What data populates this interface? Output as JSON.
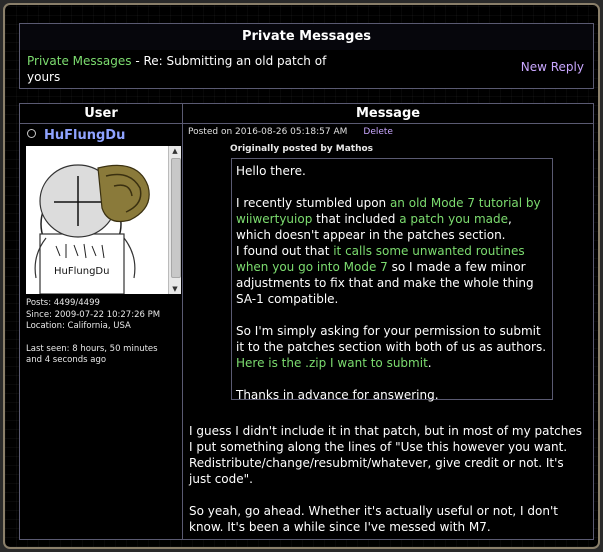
{
  "header": {
    "title": "Private Messages"
  },
  "subheader": {
    "breadcrumb_link": "Private Messages",
    "breadcrumb_sep": " - ",
    "breadcrumb_subject": "Re: Submitting an old patch of yours",
    "new_reply": "New Reply"
  },
  "table": {
    "user_col": "User",
    "message_col": "Message"
  },
  "user": {
    "name": "HuFlungDu",
    "avatar_caption": "HuFlungDu",
    "posts": "Posts: 4499/4499",
    "since": "Since: 2009-07-22 10:27:26 PM",
    "location": "Location: California, USA",
    "last_seen_1": "Last seen: 8 hours, 50 minutes",
    "last_seen_2": "and 4 seconds ago"
  },
  "post": {
    "posted_on": "Posted on 2016-08-26 05:18:57 AM",
    "delete": "Delete",
    "quote_header": "Originally posted by Mathos",
    "quote": {
      "greeting": "Hello there.",
      "p2_a": "I recently stumbled upon ",
      "p2_link1": "an old Mode 7 tutorial by wiiwertyuiop",
      "p2_b": " that included ",
      "p2_link2": "a patch you made",
      "p2_c": ", which doesn't appear in the patches section.",
      "p2_d": "I found out that ",
      "p2_link3": "it calls some unwanted routines when you go into Mode 7",
      "p2_e": " so I made a few minor adjustments to fix that and make the whole thing SA-1 compatible.",
      "p3_a": "So I'm simply asking for your permission to submit it to the patches section with both of us as authors.",
      "p3_link": "Here is the .zip I want to submit",
      "p3_b": ".",
      "thanks": "Thanks in advance for answering."
    },
    "reply_p1": "I guess I didn't include it in that patch, but in most of my patches I put something along the lines of \"Use this however you want. Redistribute/change/resubmit/whatever, give credit or not. It's just code\".",
    "reply_p2": "So yeah, go ahead. Whether it's actually useful or not, I don't know. It's been a while since I've messed with M7."
  },
  "colors": {
    "link_green": "#7cdc6f",
    "link_purple": "#c9a7ff",
    "username_blue": "#8fa3ff",
    "border": "#5a5a72",
    "frame": "#8a7f6a"
  }
}
